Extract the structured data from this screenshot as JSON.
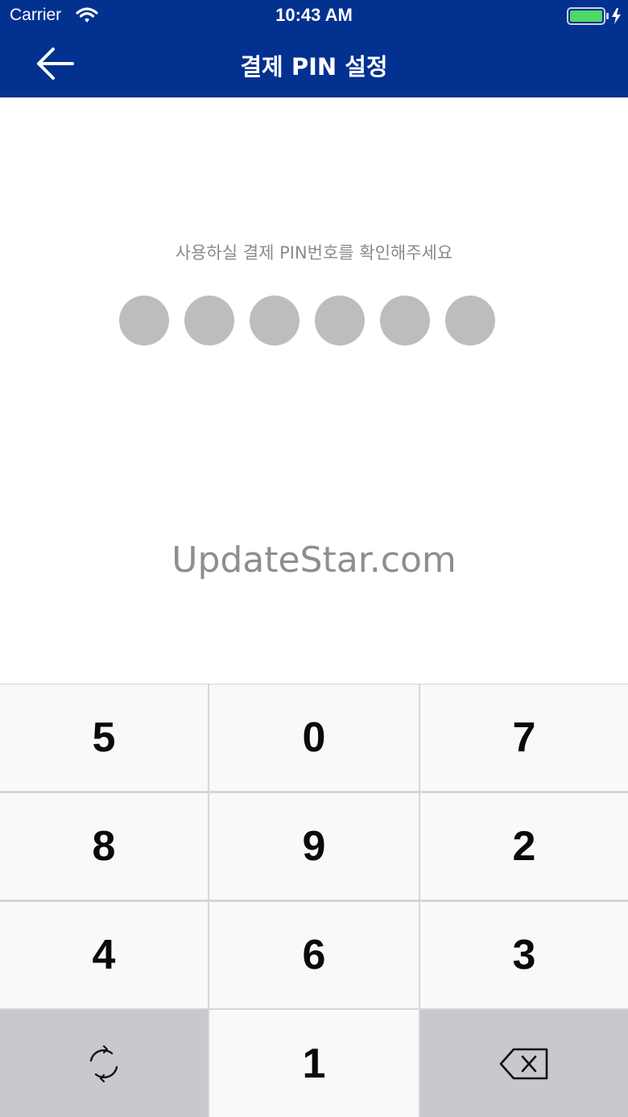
{
  "status_bar": {
    "carrier": "Carrier",
    "time": "10:43 AM",
    "icons": [
      "wifi-icon",
      "battery-icon",
      "charging-bolt-icon"
    ],
    "battery_color": "#4cd964"
  },
  "nav": {
    "title": "결제 PIN 설정",
    "back_icon": "arrow-left-icon",
    "background_color": "#023190"
  },
  "prompt": {
    "text": "사용하실 결제 PIN번호를 확인해주세요"
  },
  "pin": {
    "length": 6,
    "entered": 0,
    "dot_color": "#bdbdbd"
  },
  "watermark": "UpdateStar.com",
  "keypad": {
    "keys": [
      "5",
      "0",
      "7",
      "8",
      "9",
      "2",
      "4",
      "6",
      "3"
    ],
    "bottom_left_icon": "shuffle-icon",
    "bottom_center": "1",
    "bottom_right_icon": "backspace-icon"
  }
}
